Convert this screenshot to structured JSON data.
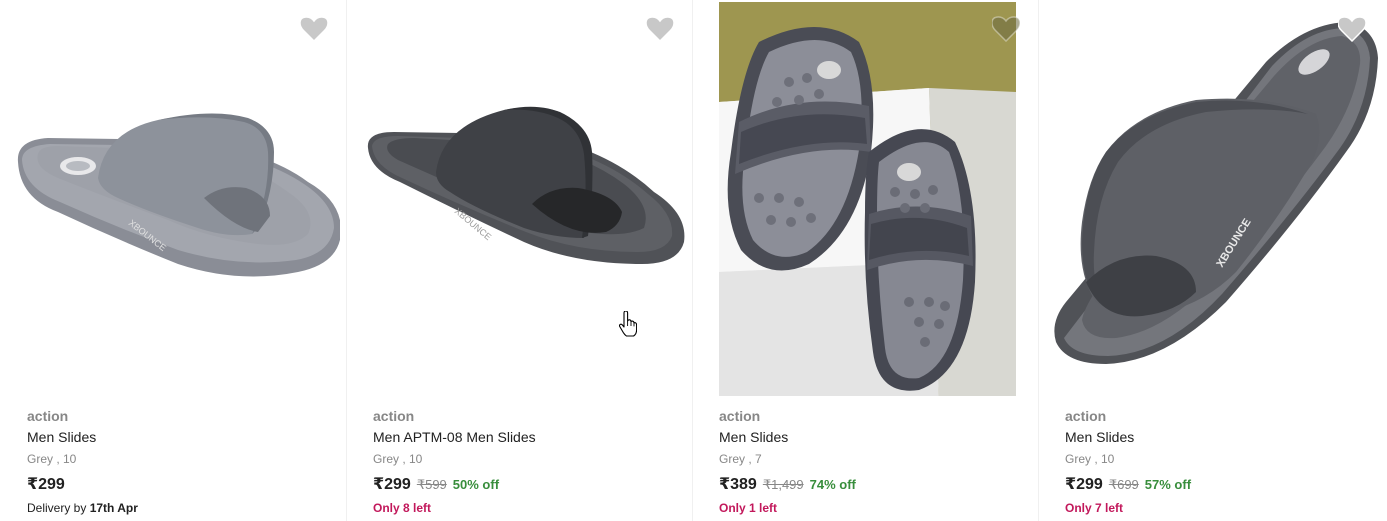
{
  "products": [
    {
      "image": "grey slide sandal, side view",
      "wishlist_icon": "heart-icon",
      "brand": "action",
      "title": "Men Slides",
      "variant": "Grey , 10",
      "price": "₹299",
      "mrp": "",
      "discount": "",
      "delivery_prefix": "Delivery by ",
      "delivery_date": "17th Apr",
      "stock_note": ""
    },
    {
      "image": "dark grey slide sandal, side view",
      "wishlist_icon": "heart-icon",
      "brand": "action",
      "title": "Men APTM-08 Men Slides",
      "variant": "Grey , 10",
      "price": "₹299",
      "mrp": "₹599",
      "discount": "50% off",
      "delivery_prefix": "",
      "delivery_date": "",
      "stock_note": "Only 8 left"
    },
    {
      "image": "pair of grey slides on white blocks, olive background",
      "wishlist_icon": "heart-icon",
      "brand": "action",
      "title": "Men Slides",
      "variant": "Grey , 7",
      "price": "₹389",
      "mrp": "₹1,499",
      "discount": "74% off",
      "delivery_prefix": "",
      "delivery_date": "",
      "stock_note": "Only 1 left"
    },
    {
      "image": "dark grey slide sandal, angled view",
      "wishlist_icon": "heart-icon",
      "brand": "action",
      "title": "Men Slides",
      "variant": "Grey , 10",
      "price": "₹299",
      "mrp": "₹699",
      "discount": "57% off",
      "delivery_prefix": "",
      "delivery_date": "",
      "stock_note": "Only 7 left"
    }
  ],
  "colors": {
    "brand_text": "#878787",
    "discount_green": "#388e3c",
    "stock_pink": "#c2185b",
    "heart_grey": "#c8c8c8"
  },
  "cursor_icon": "hand-pointer-icon"
}
